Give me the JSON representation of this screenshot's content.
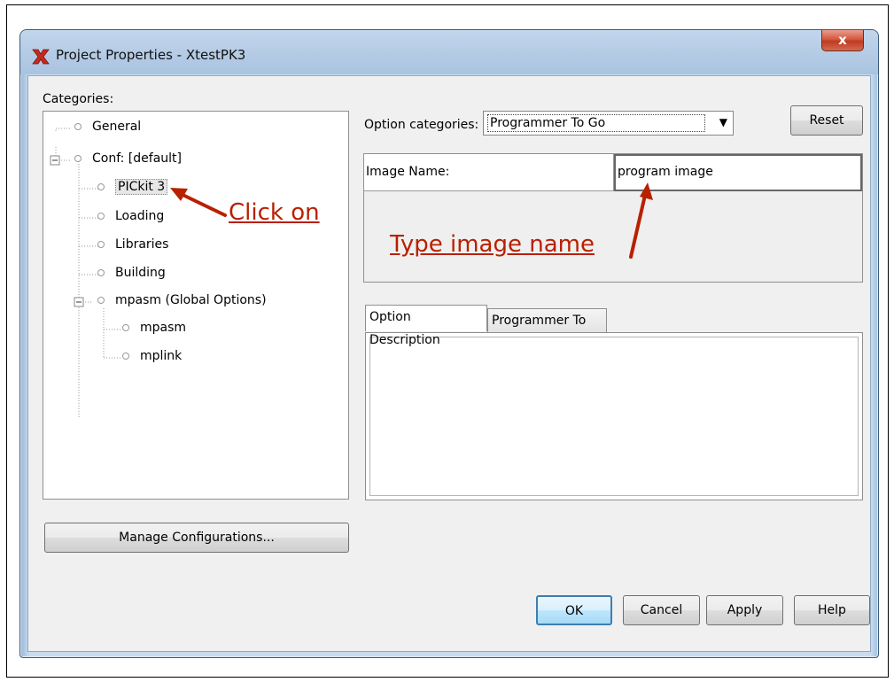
{
  "window": {
    "title": "Project Properties - XtestPK3",
    "close_label": "x"
  },
  "categories": {
    "label": "Categories:",
    "tree": [
      {
        "label": "General"
      },
      {
        "label": "Conf: [default]"
      },
      {
        "label": "PICkit 3"
      },
      {
        "label": "Loading"
      },
      {
        "label": "Libraries"
      },
      {
        "label": "Building"
      },
      {
        "label": "mpasm (Global Options)"
      },
      {
        "label": "mpasm"
      },
      {
        "label": "mplink"
      }
    ],
    "expand_symbol": "−",
    "manage_button": "Manage Configurations..."
  },
  "options": {
    "category_label": "Option categories:",
    "category_value": "Programmer To Go",
    "dropdown_arrow": "▼",
    "reset_button": "Reset",
    "property_name": "Image Name:",
    "property_value": "program image"
  },
  "tabs": [
    {
      "label": "Option Description"
    },
    {
      "label": "Programmer To Go"
    }
  ],
  "buttons": {
    "ok": "OK",
    "cancel": "Cancel",
    "apply": "Apply",
    "help": "Help"
  },
  "annotations": {
    "click_on": "Click on",
    "type_image_name": "Type image name",
    "color": "#b82000"
  }
}
